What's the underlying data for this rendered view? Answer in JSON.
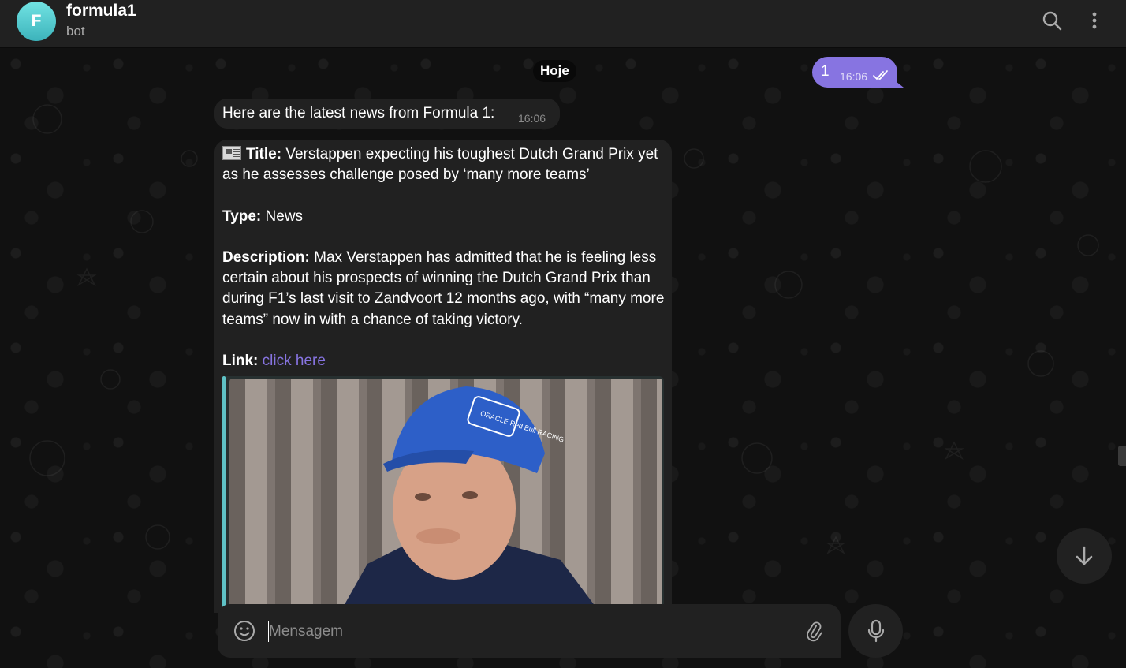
{
  "header": {
    "avatar_letter": "F",
    "title": "formula1",
    "subtitle": "bot",
    "search_icon": "search-icon",
    "menu_icon": "more-vertical-icon"
  },
  "date_separator": "Hoje",
  "outgoing": {
    "text": "1",
    "time": "16:06",
    "status_icon": "double-check-icon"
  },
  "incoming_intro": {
    "text": "Here are the latest news from Formula 1:",
    "time": "16:06"
  },
  "news": {
    "title_label": "Title:",
    "title_value": "Verstappen expecting his toughest Dutch Grand Prix yet as he assesses challenge posed by ‘many more teams’",
    "type_label": "Type:",
    "type_value": "News",
    "description_label": "Description:",
    "description_value": "Max Verstappen has admitted that he is feeling less certain about his prospects of winning the Dutch Grand Prix than during F1’s last visit to Zandvoort 12 months ago, with “many more teams” now in with a chance of taking victory.",
    "link_label": "Link:",
    "link_text": "click here",
    "image_cap_text": "ORACLE Red Bull RACING"
  },
  "composer": {
    "placeholder": "Mensagem"
  },
  "colors": {
    "accent": "#8774e1",
    "bubble_bg": "#212121",
    "header_bg": "#212121",
    "avatar_bg": "#5fc9cc"
  }
}
